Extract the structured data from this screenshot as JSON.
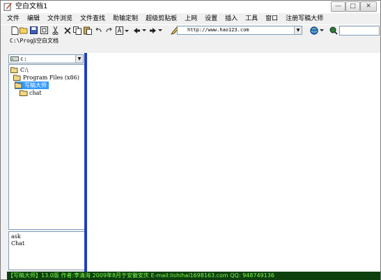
{
  "window": {
    "title": "空白文档1",
    "minimize_glyph": "—",
    "maximize_glyph": "□",
    "close_glyph": "✕"
  },
  "menu": {
    "items": [
      "文件",
      "编辑",
      "文件浏览",
      "文件查找",
      "助输定制",
      "超级剪贴板",
      "上网",
      "设置",
      "插入",
      "工具",
      "窗口",
      "注册写稿大师"
    ]
  },
  "toolbar": {
    "address": "http://www.hao123.com",
    "icons": [
      "new-document-icon",
      "open-folder-icon",
      "save-icon",
      "fullscreen-icon",
      "cut-icon",
      "delete-icon",
      "copy-icon",
      "paste-icon",
      "undo-icon",
      "redo-icon",
      "font-icon",
      "back-icon",
      "forward-icon",
      "go-icon"
    ]
  },
  "pathbar": {
    "path": "C:\\Progi",
    "document_tab": "空白文档"
  },
  "explorer": {
    "drive": "c:",
    "tree": [
      "C:\\",
      "Program Files (x86)",
      "写稿大师",
      "chat"
    ],
    "selected": "写稿大师"
  },
  "bottom_list": {
    "items": [
      "ask",
      "Chat"
    ]
  },
  "status": {
    "text": "【写稿大师】13.0版  作者:李清海  2009年8月于安徽安庆  E-mail:lishihai1698163.com  QQ: 948749136"
  },
  "colors": {
    "status_bg": "#0d3f0d",
    "status_fg": "#7dff4a",
    "splitter": "#1f3fbf",
    "selection": "#3399ff"
  }
}
